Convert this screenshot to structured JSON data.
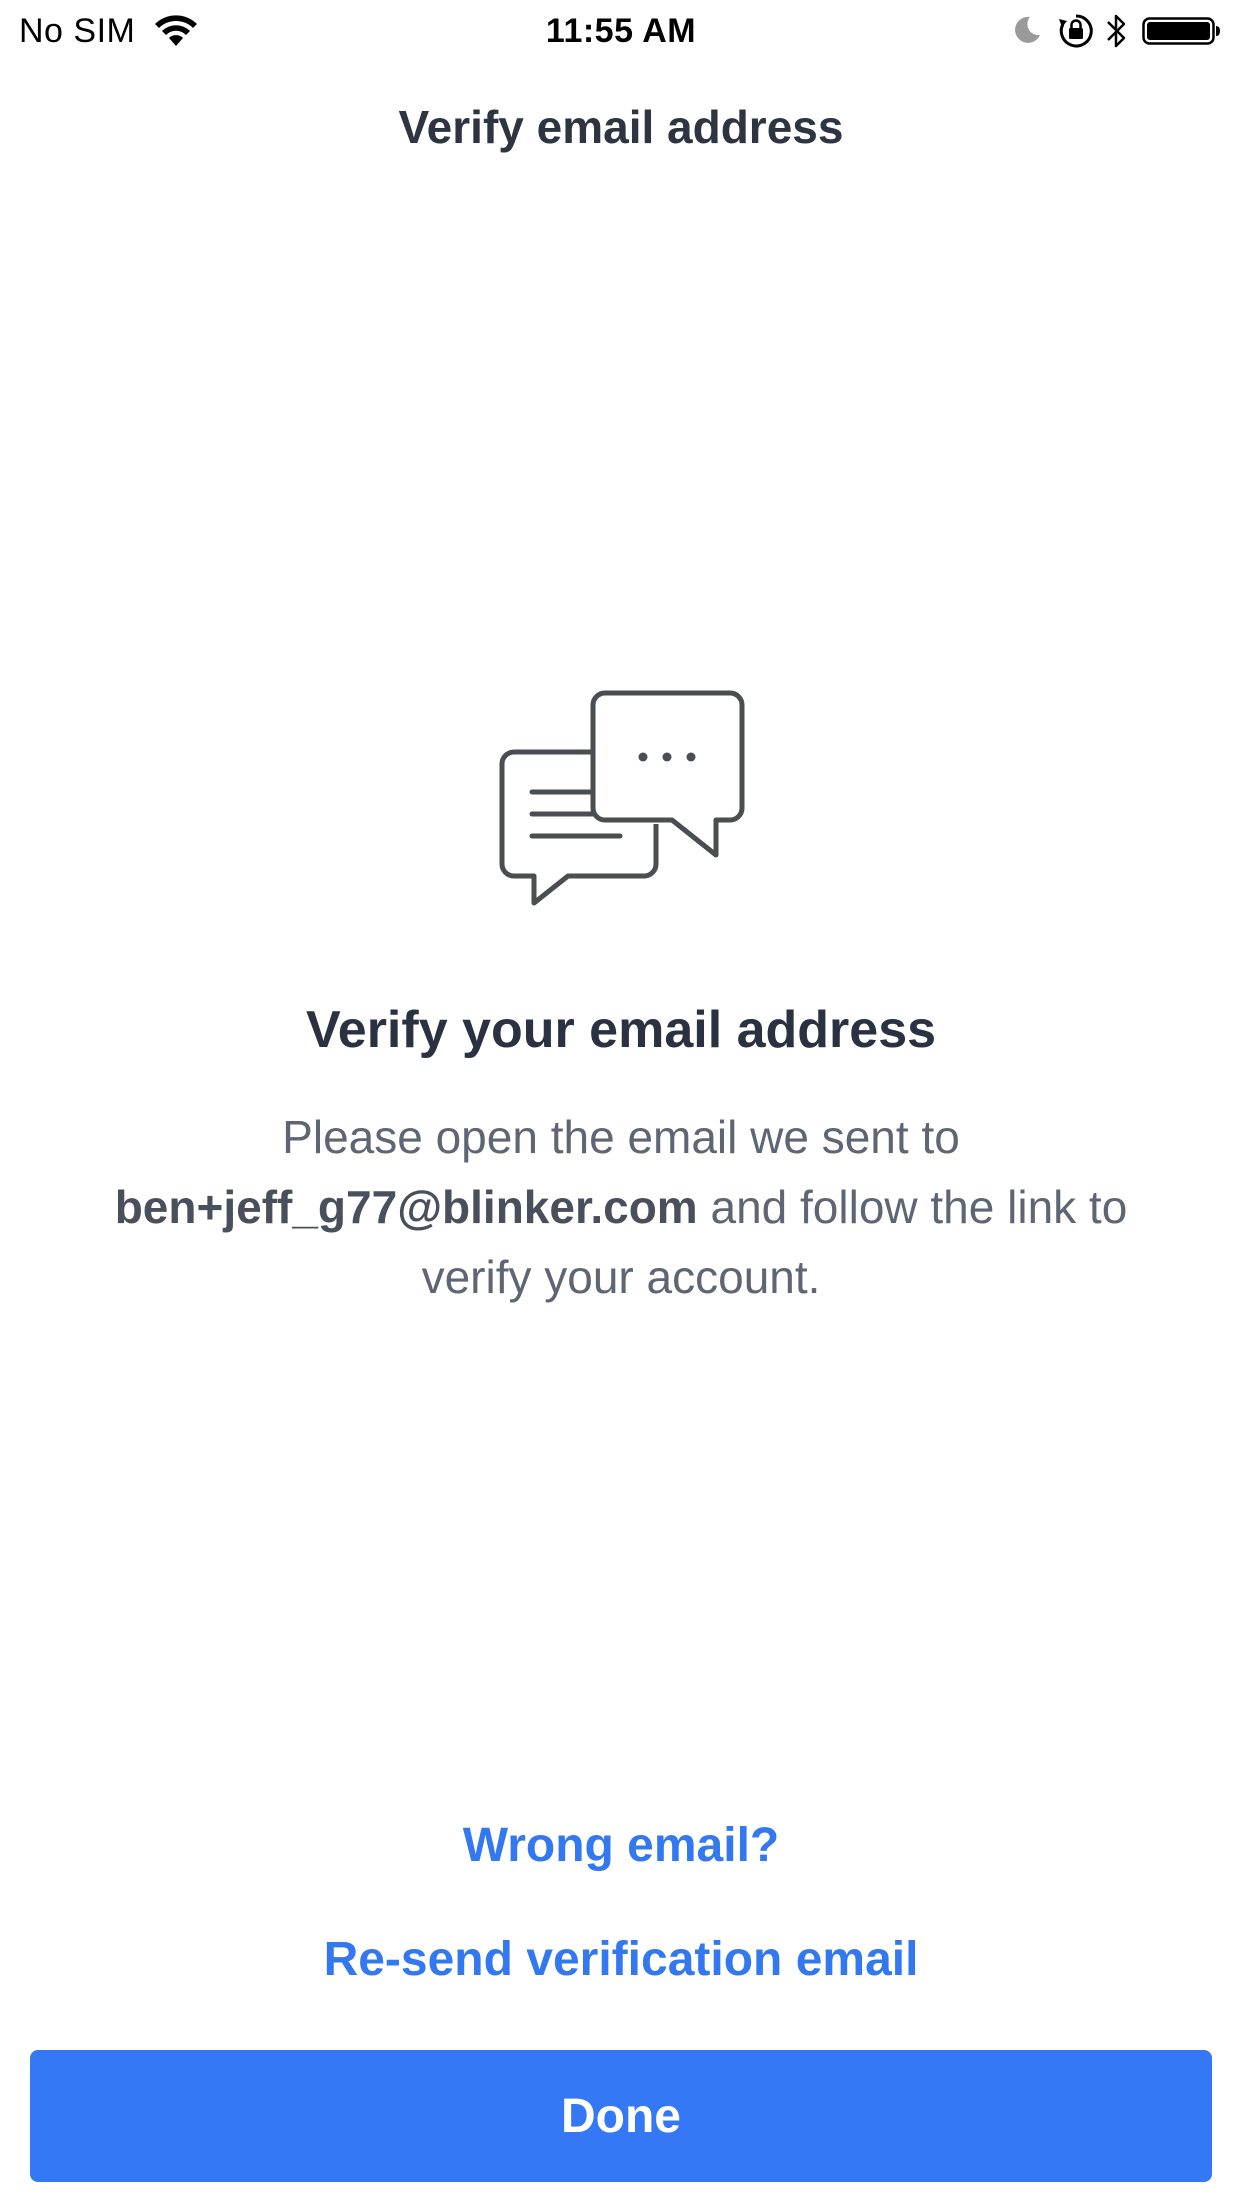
{
  "status_bar": {
    "carrier": "No SIM",
    "time": "11:55 AM",
    "icons": [
      "wifi-icon",
      "moon-icon",
      "orientation-lock-icon",
      "bluetooth-icon",
      "battery-icon"
    ]
  },
  "nav": {
    "title": "Verify email address"
  },
  "content": {
    "illustration": "chat-bubbles-icon",
    "heading": "Verify your email address",
    "body_prefix": "Please open the email we sent to",
    "email": "ben+jeff_g77@blinker.com",
    "body_suffix": "and follow the link to verify your account."
  },
  "actions": {
    "wrong_email": "Wrong email?",
    "resend": "Re-send verification email",
    "done": "Done"
  },
  "colors": {
    "accent": "#3478f6",
    "link": "#3478f0",
    "heading": "#2a3140",
    "body": "#5f6673"
  }
}
